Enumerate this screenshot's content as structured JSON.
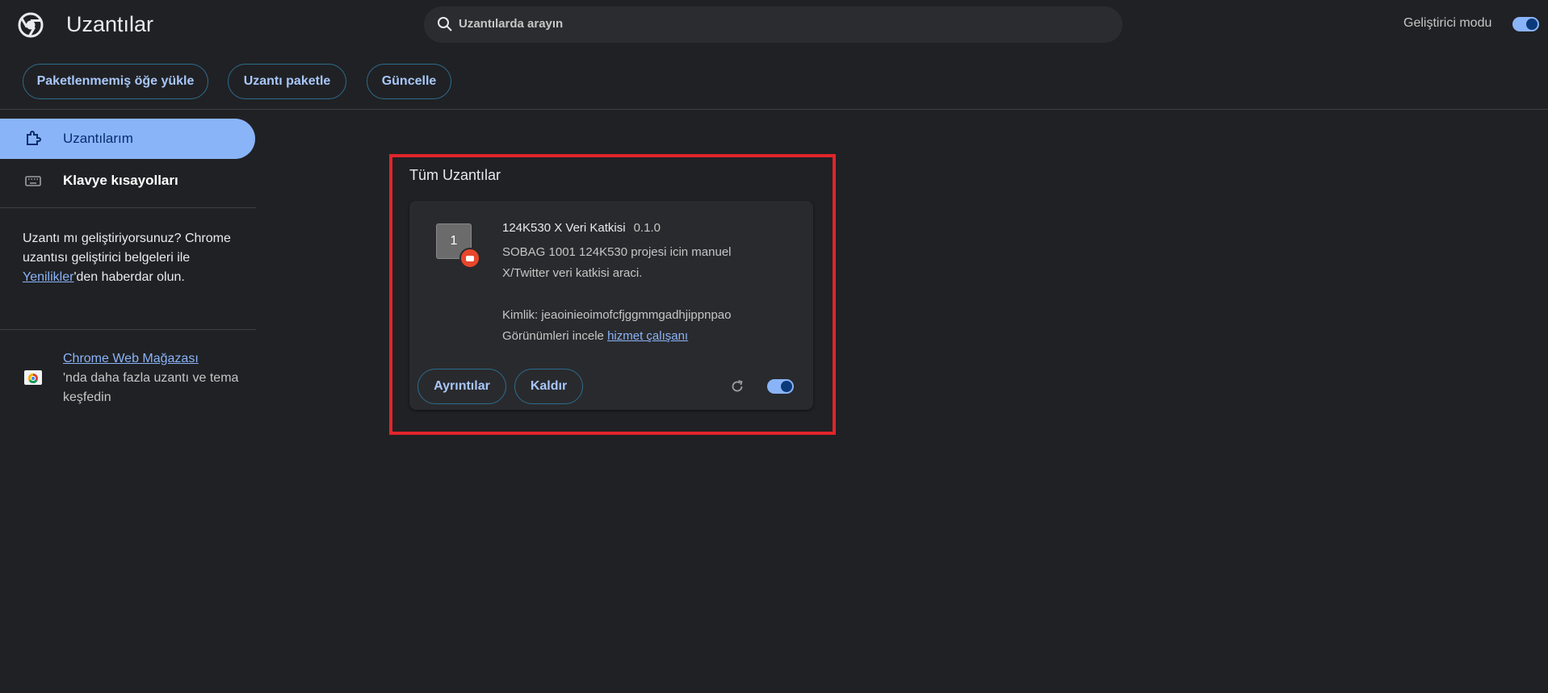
{
  "header": {
    "title": "Uzantılar",
    "search_placeholder": "Uzantılarda arayın",
    "devmode_label": "Geliştirici modu",
    "devmode_on": true
  },
  "toolbar": {
    "load_unpacked": "Paketlenmemiş öğe yükle",
    "pack_extension": "Uzantı paketle",
    "update": "Güncelle"
  },
  "sidebar": {
    "items": [
      {
        "label": "Uzantılarım",
        "icon": "extension-icon",
        "active": true
      },
      {
        "label": "Klavye kısayolları",
        "icon": "keyboard-icon",
        "active": false
      }
    ],
    "dev_text_before": "Uzantı mı geliştiriyorsunuz? Chrome uzantısı geliştirici belgeleri ile ",
    "dev_link": "Yenilikler",
    "dev_text_after": "'den haberdar olun.",
    "store_link": "Chrome Web Mağazası",
    "store_text": "'nda daha fazla uzantı ve tema keşfedin"
  },
  "main": {
    "section_title": "Tüm Uzantılar",
    "extension": {
      "icon_text": "1",
      "name": "124K530 X Veri Katkisi",
      "version": "0.1.0",
      "description": "SOBAG 1001 124K530 projesi icin manuel X/Twitter veri katkisi araci.",
      "id_label": "Kimlik: jeaoinieoimofcfjggmmgadhjippnpao",
      "views_label": "Görünümleri incele",
      "views_link": "hizmet çalışanı",
      "details_button": "Ayrıntılar",
      "remove_button": "Kaldır",
      "enabled": true
    }
  },
  "colors": {
    "background": "#202124",
    "accent": "#8ab4f8",
    "highlight": "#e0252b"
  }
}
